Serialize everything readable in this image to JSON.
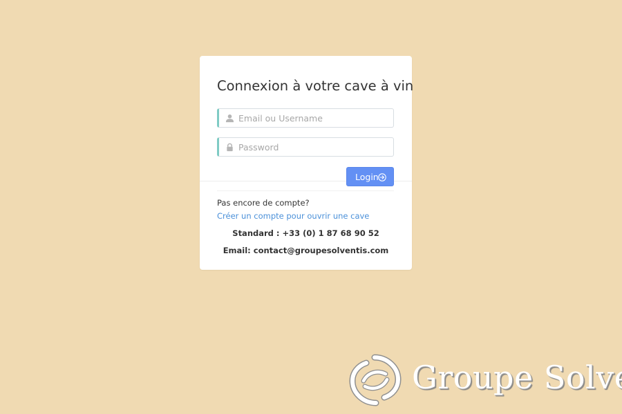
{
  "colors": {
    "background": "#f0dab2",
    "card": "#ffffff",
    "input_accent": "#7fcbc4",
    "primary_button": "#6390f4",
    "link": "#4a90d9"
  },
  "login_card": {
    "title": "Connexion à votre cave à vin",
    "email_field": {
      "placeholder": "Email ou Username",
      "value": "",
      "icon": "user-icon"
    },
    "password_field": {
      "placeholder": "Password",
      "value": "",
      "icon": "lock-icon"
    },
    "login_button": {
      "label": "Login",
      "icon": "arrow-circle-right-icon"
    },
    "no_account_text": "Pas encore de compte?",
    "create_account_link": "Créer un compte pour ouvrir une cave",
    "phone_line": "Standard : +33 (0) 1 87 68 90 52",
    "email_line": "Email: contact@groupesolventis.com"
  },
  "brand": {
    "name": "Groupe Solventis",
    "logo_icon": "swirl-logo-icon"
  }
}
